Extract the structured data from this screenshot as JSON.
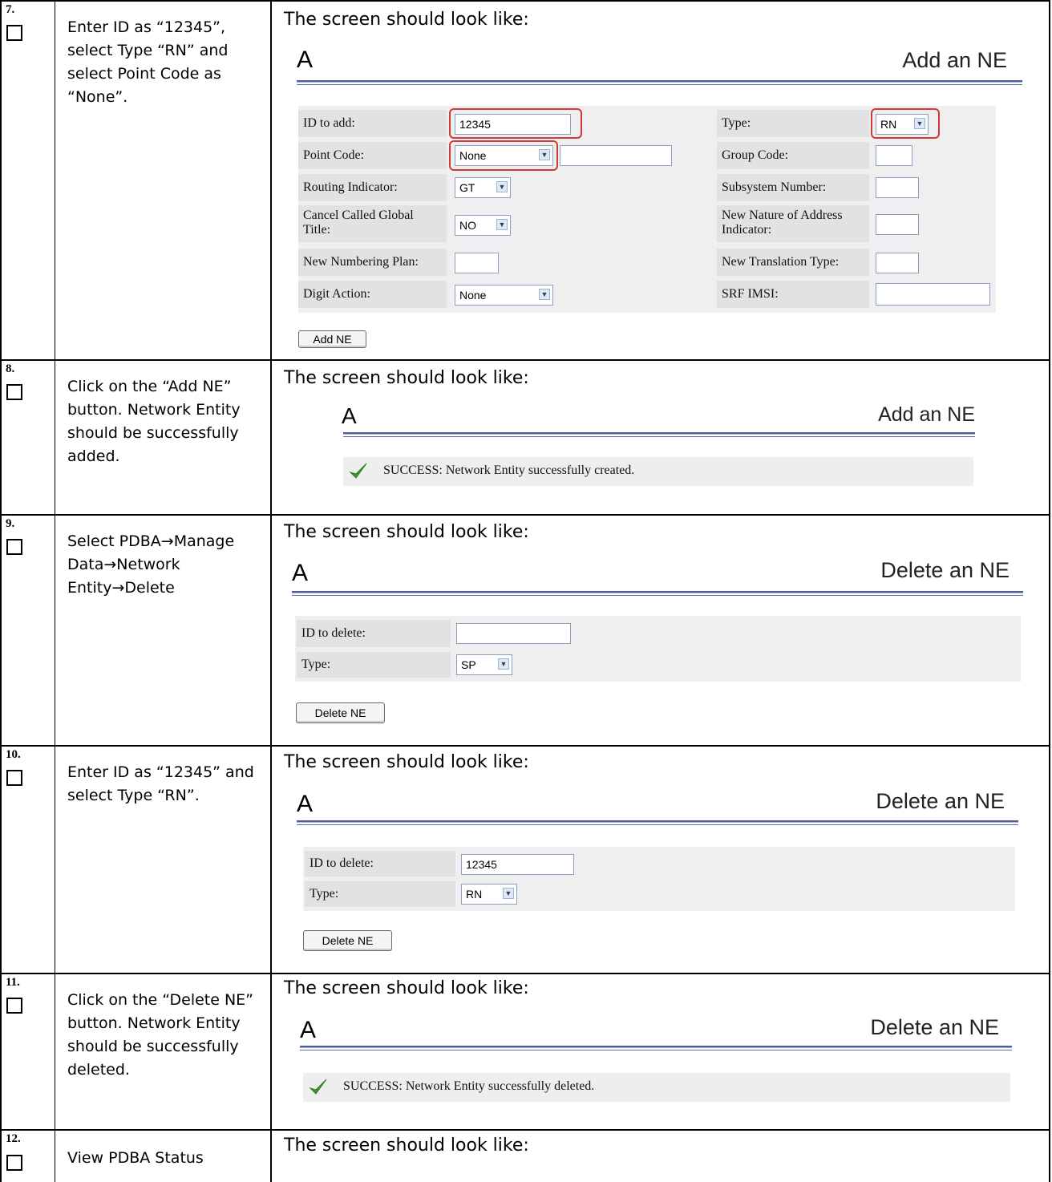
{
  "rows": [
    {
      "step": "7.",
      "description": "Enter ID as “12345”, select Type “RN” and select Point Code as “None”."
    },
    {
      "step": "8.",
      "description": "Click on the “Add NE” button. Network Entity should be successfully added."
    },
    {
      "step": "9.",
      "description": "Select PDBA→Manage Data→Network Entity→Delete"
    },
    {
      "step": "10.",
      "description": "Enter ID as “12345” and select Type “RN”."
    },
    {
      "step": "11.",
      "description": "Click on the “Delete NE” button. Network Entity should be successfully deleted."
    },
    {
      "step": "12.",
      "description": "View PDBA Status"
    }
  ],
  "intro": "The screen should look like:",
  "logo": "A",
  "add_form": {
    "title": "Add an NE",
    "labels": {
      "id": "ID to add:",
      "point_code": "Point Code:",
      "routing_indicator": "Routing Indicator:",
      "cancel_called": "Cancel Called Global Title:",
      "new_numbering_plan": "New Numbering Plan:",
      "digit_action": "Digit Action:",
      "type": "Type:",
      "group_code": "Group Code:",
      "subsystem_number": "Subsystem Number:",
      "new_nature": "New Nature of Address Indicator:",
      "new_translation_type": "New Translation Type:",
      "srf_imsi": "SRF IMSI:"
    },
    "values": {
      "id": "12345",
      "point_code": "None",
      "routing_indicator": "GT",
      "cancel_called": "NO",
      "digit_action": "None",
      "type": "RN"
    },
    "button": "Add NE"
  },
  "add_success": {
    "title": "Add an NE",
    "message": "SUCCESS: Network Entity successfully created."
  },
  "delete_form_empty": {
    "title": "Delete an NE",
    "labels": {
      "id": "ID to delete:",
      "type": "Type:"
    },
    "values": {
      "id": "",
      "type": "SP"
    },
    "button": "Delete NE"
  },
  "delete_form_filled": {
    "title": "Delete an NE",
    "labels": {
      "id": "ID to delete:",
      "type": "Type:"
    },
    "values": {
      "id": "12345",
      "type": "RN"
    },
    "button": "Delete NE"
  },
  "delete_success": {
    "title": "Delete an NE",
    "message": "SUCCESS: Network Entity successfully deleted."
  },
  "colors": {
    "highlight": "#d03a3a",
    "rule": "#4a5f9a",
    "check": "#3a9a2a"
  }
}
